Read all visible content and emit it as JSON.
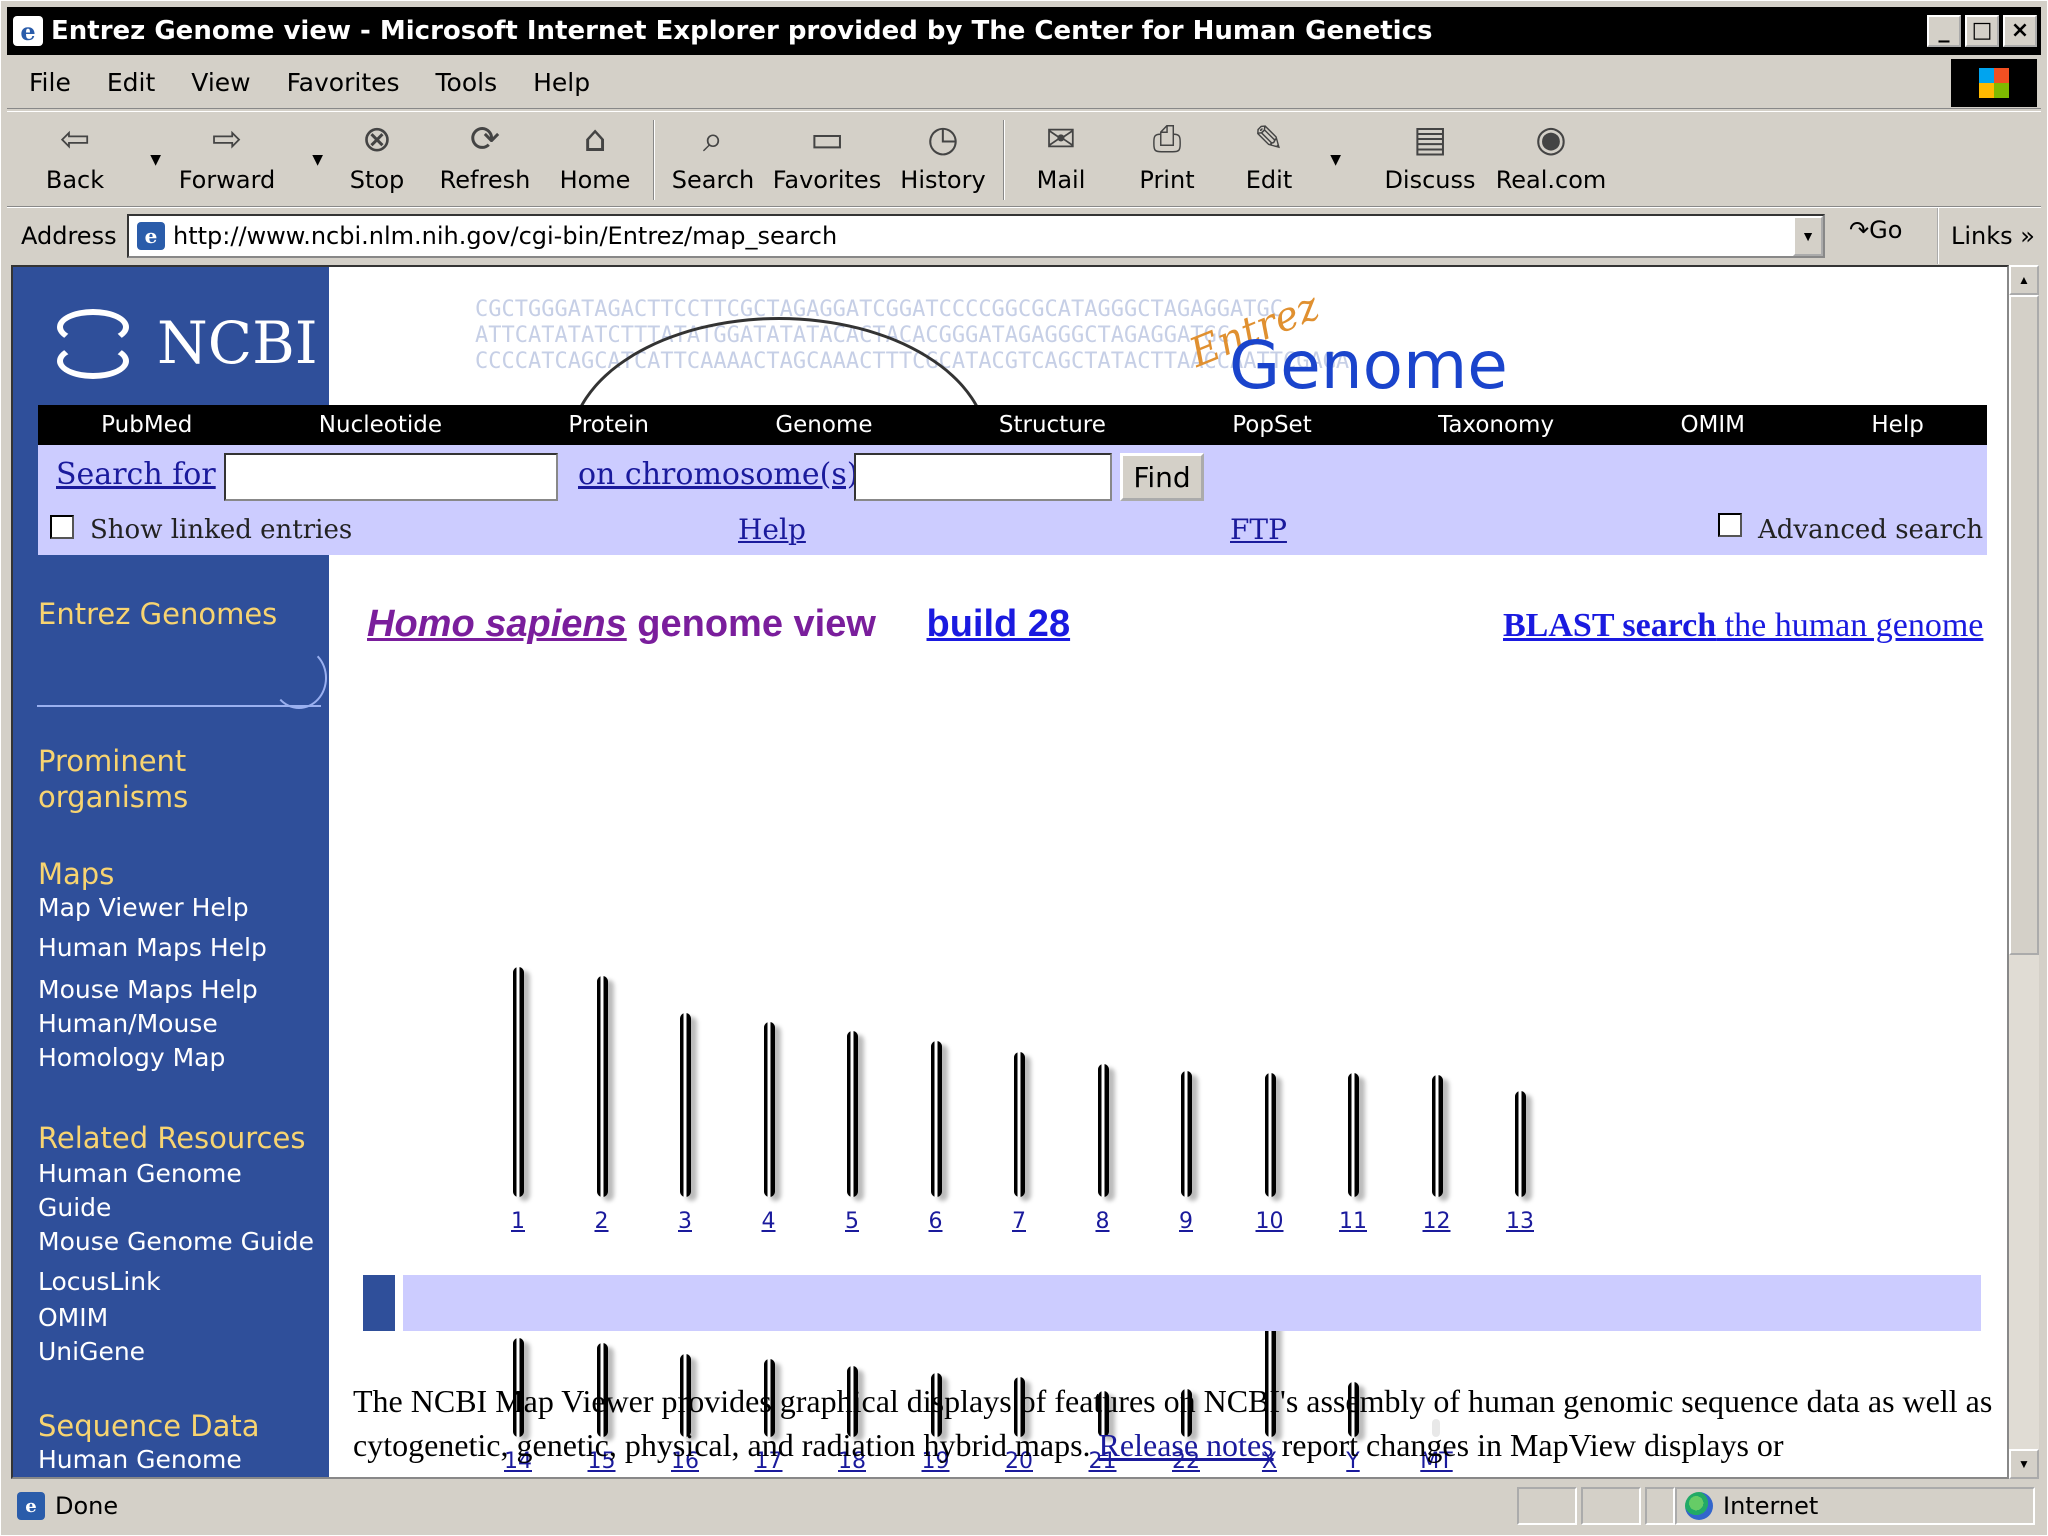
{
  "window": {
    "title": "Entrez Genome view - Microsoft Internet Explorer provided by The Center for Human Genetics"
  },
  "menu": [
    "File",
    "Edit",
    "View",
    "Favorites",
    "Tools",
    "Help"
  ],
  "toolbar": {
    "back": "Back",
    "forward": "Forward",
    "stop": "Stop",
    "refresh": "Refresh",
    "home": "Home",
    "search": "Search",
    "favorites": "Favorites",
    "history": "History",
    "mail": "Mail",
    "print": "Print",
    "edit": "Edit",
    "discuss": "Discuss",
    "real": "Real.com"
  },
  "address": {
    "label": "Address",
    "url": "http://www.ncbi.nlm.nih.gov/cgi-bin/Entrez/map_search",
    "go": "Go",
    "links": "Links"
  },
  "status": {
    "text": "Done",
    "zone": "Internet"
  },
  "banner": {
    "logo": "NCBI",
    "entrez": "Entrez",
    "genome": "Genome",
    "dna": [
      "CGCTGGGATAGACTTCCTTCGCTAGAGGATCGGATCCCCGGCGCATAGGGCTAGAGGATGC",
      "ATTCATATATCTTTATATGGATATATACACTACACGGGATAGAGGGCTAGAGGATGC",
      "CCCCATCAGCATCATTCAAAACTAGCAAACTTTCGCATACGTCAGCTATACTTAACCAATTCGAGA"
    ]
  },
  "nav": [
    "PubMed",
    "Nucleotide",
    "Protein",
    "Genome",
    "Structure",
    "PopSet",
    "Taxonomy",
    "OMIM",
    "Help"
  ],
  "search": {
    "search_for": "Search for",
    "on_chromosome": "on chromosome(s)",
    "find": "Find",
    "show_linked": "Show linked entries",
    "help": "Help",
    "ftp": "FTP",
    "advanced": "Advanced search"
  },
  "sidebar": {
    "entrez_genomes": "Entrez Genomes",
    "prominent": "Prominent organisms",
    "maps": "Maps",
    "map_viewer_help": "Map Viewer Help",
    "human_maps_help": "Human Maps Help",
    "mouse_maps_help": "Mouse Maps Help",
    "human_mouse": "Human/Mouse Homology Map",
    "related": "Related Resources",
    "human_genome_guide": "Human Genome Guide",
    "mouse_genome_guide": "Mouse Genome Guide",
    "locuslink": "LocusLink",
    "omim": "OMIM",
    "unigene": "UniGene",
    "sequence": "Sequence Data",
    "human_genome": "Human Genome"
  },
  "heading": {
    "species": "Homo sapiens",
    "rest": " genome view",
    "build": "build 28",
    "blast_bold": "BLAST search",
    "blast_rest": " the human genome"
  },
  "chromosomes": [
    {
      "label": "1",
      "len": 1.0,
      "cen": 0.48
    },
    {
      "label": "2",
      "len": 0.96,
      "cen": 0.38
    },
    {
      "label": "3",
      "len": 0.8,
      "cen": 0.46
    },
    {
      "label": "4",
      "len": 0.76,
      "cen": 0.27
    },
    {
      "label": "5",
      "len": 0.72,
      "cen": 0.27
    },
    {
      "label": "6",
      "len": 0.68,
      "cen": 0.35
    },
    {
      "label": "7",
      "len": 0.63,
      "cen": 0.36
    },
    {
      "label": "8",
      "len": 0.58,
      "cen": 0.3
    },
    {
      "label": "9",
      "len": 0.55,
      "cen": 0.33
    },
    {
      "label": "10",
      "len": 0.54,
      "cen": 0.3
    },
    {
      "label": "11",
      "len": 0.54,
      "cen": 0.37
    },
    {
      "label": "12",
      "len": 0.53,
      "cen": 0.26
    },
    {
      "label": "13",
      "len": 0.46,
      "cen": 0.12
    },
    {
      "label": "14",
      "len": 0.43,
      "cen": 0.13
    },
    {
      "label": "15",
      "len": 0.41,
      "cen": 0.14
    },
    {
      "label": "16",
      "len": 0.36,
      "cen": 0.4
    },
    {
      "label": "17",
      "len": 0.34,
      "cen": 0.3
    },
    {
      "label": "18",
      "len": 0.31,
      "cen": 0.28
    },
    {
      "label": "19",
      "len": 0.28,
      "cen": 0.46
    },
    {
      "label": "20",
      "len": 0.26,
      "cen": 0.45
    },
    {
      "label": "21",
      "len": 0.2,
      "cen": 0.23
    },
    {
      "label": "22",
      "len": 0.21,
      "cen": 0.24
    },
    {
      "label": "X",
      "len": 0.61,
      "cen": 0.36
    },
    {
      "label": "Y",
      "len": 0.24,
      "cen": 0.25
    },
    {
      "label": "MT",
      "len": 0.05,
      "cen": 0.0
    }
  ],
  "description": {
    "p1": "The NCBI Map Viewer provides graphical displays of features on NCBI's assembly of human genomic sequence data as well as cytogenetic, genetic, physical, and radiation hybrid maps. ",
    "release": "Release notes",
    "p2": " report changes in MapView displays or"
  }
}
